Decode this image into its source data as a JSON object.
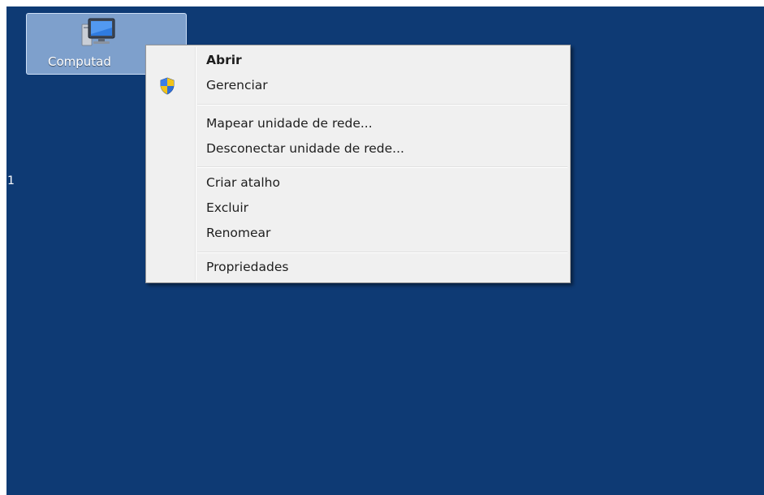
{
  "desktop": {
    "background_color": "#0e3a74",
    "icon": {
      "label": "Computad",
      "icon_name": "computer-icon"
    },
    "left_edge_glyph": "1"
  },
  "context_menu": {
    "items": [
      {
        "label": "Abrir",
        "bold": true,
        "icon": null
      },
      {
        "label": "Gerenciar",
        "bold": false,
        "icon": "uac-shield-icon"
      },
      {
        "label": "Mapear unidade de rede...",
        "bold": false,
        "icon": null
      },
      {
        "label": "Desconectar unidade de rede...",
        "bold": false,
        "icon": null
      },
      {
        "label": "Criar atalho",
        "bold": false,
        "icon": null
      },
      {
        "label": "Excluir",
        "bold": false,
        "icon": null
      },
      {
        "label": "Renomear",
        "bold": false,
        "icon": null
      },
      {
        "label": "Propriedades",
        "bold": false,
        "icon": null
      }
    ]
  }
}
